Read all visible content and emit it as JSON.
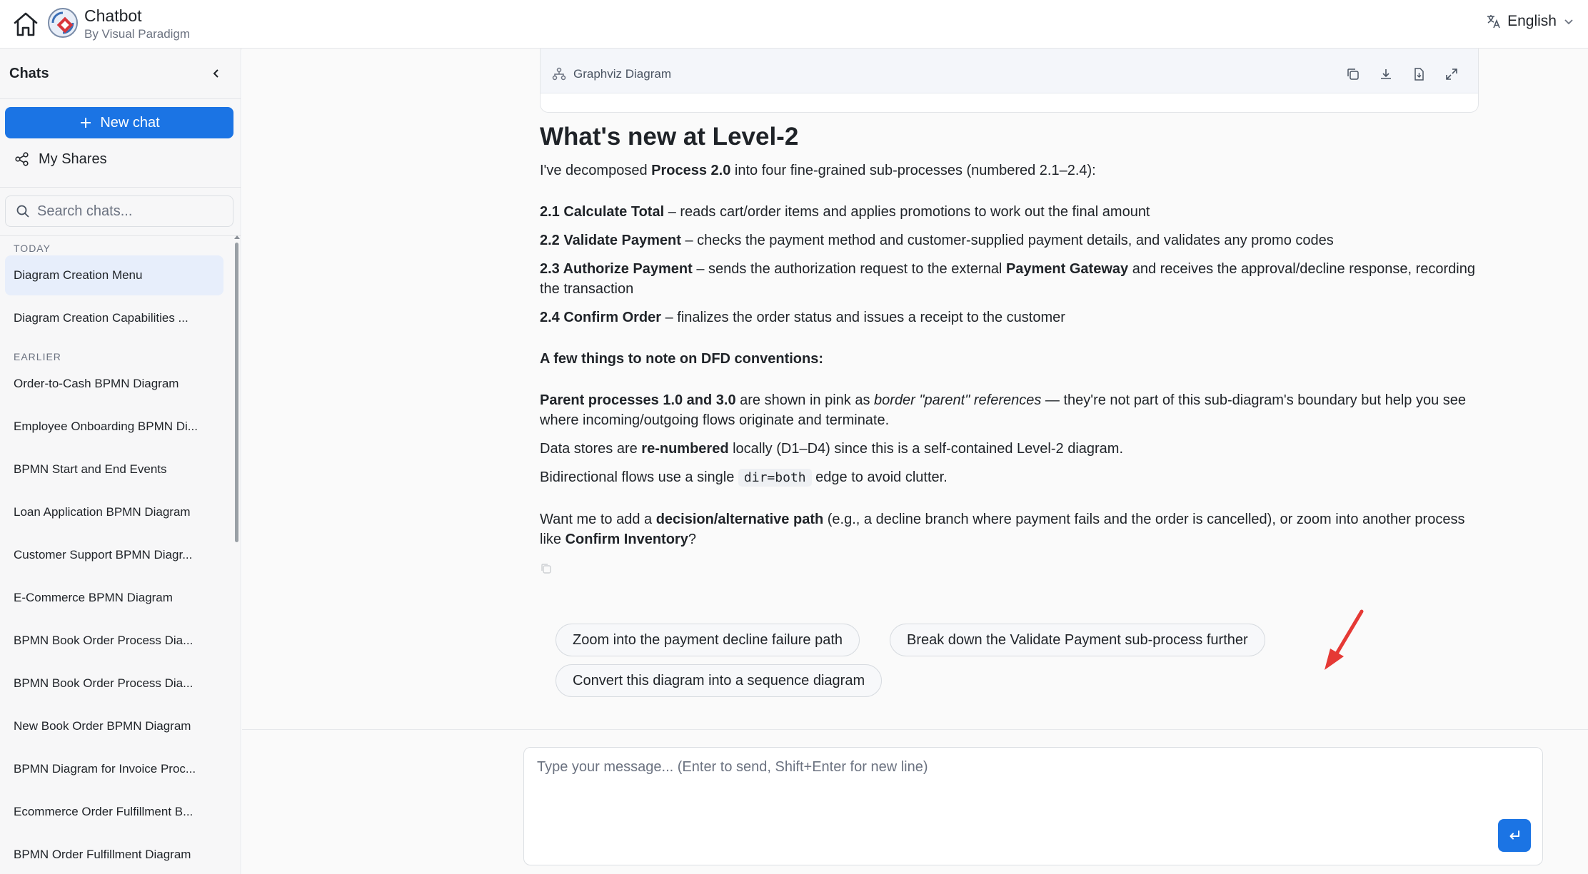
{
  "header": {
    "app_title": "Chatbot",
    "app_subtitle": "By Visual Paradigm",
    "language": "English"
  },
  "sidebar": {
    "title": "Chats",
    "new_chat_label": "New chat",
    "my_shares_label": "My Shares",
    "search_placeholder": "Search chats...",
    "sections": [
      {
        "label": "TODAY",
        "items": [
          "Diagram Creation Menu",
          "Diagram Creation Capabilities ..."
        ]
      },
      {
        "label": "EARLIER",
        "items": [
          "Order-to-Cash BPMN Diagram",
          "Employee Onboarding BPMN Di...",
          "BPMN Start and End Events",
          "Loan Application BPMN Diagram",
          "Customer Support BPMN Diagr...",
          "E-Commerce BPMN Diagram",
          "BPMN Book Order Process Dia...",
          "BPMN Book Order Process Dia...",
          "New Book Order BPMN Diagram",
          "BPMN Diagram for Invoice Proc...",
          "Ecommerce Order Fulfillment B...",
          "BPMN Order Fulfillment Diagram"
        ]
      }
    ],
    "active_item": "Diagram Creation Menu"
  },
  "diagram_card": {
    "title": "Graphviz Diagram",
    "tools": [
      "copy-icon",
      "download-icon",
      "export-icon",
      "fullscreen-icon"
    ]
  },
  "message": {
    "heading": "What's new at Level-2",
    "intro_pre": "I've decomposed ",
    "intro_bold": "Process 2.0",
    "intro_post": " into four fine-grained sub-processes (numbered 2.1–2.4):",
    "subprocesses": [
      {
        "bold": "2.1 Calculate Total",
        "text": " – reads cart/order items and applies promotions to work out the final amount"
      },
      {
        "bold": "2.2 Validate Payment",
        "text": " – checks the payment method and customer-supplied payment details, and validates any promo codes"
      },
      {
        "bold": "2.3 Authorize Payment",
        "text": " – sends the authorization request to the external ",
        "bold2": "Payment Gateway",
        "text2": " and receives the approval/decline response, recording the transaction"
      },
      {
        "bold": "2.4 Confirm Order",
        "text": " – finalizes the order status and issues a receipt to the customer"
      }
    ],
    "notes_heading": "A few things to note on DFD conventions:",
    "note1_bold": "Parent processes 1.0 and 3.0",
    "note1_mid": " are shown in pink as ",
    "note1_italic": "border \"parent\" references",
    "note1_post": " — they're not part of this sub-diagram's boundary but help you see where incoming/outgoing flows originate and terminate.",
    "note2_pre": "Data stores are ",
    "note2_bold": "re-numbered",
    "note2_post": " locally (D1–D4) since this is a self-contained Level-2 diagram.",
    "note3_pre": "Bidirectional flows use a single ",
    "note3_code": "dir=both",
    "note3_post": " edge to avoid clutter.",
    "closing_pre": "Want me to add a ",
    "closing_bold": "decision/alternative path",
    "closing_mid": " (e.g., a decline branch where payment fails and the order is cancelled), or zoom into another process like ",
    "closing_bold2": "Confirm Inventory",
    "closing_post": "?"
  },
  "suggestions": [
    "Zoom into the payment decline failure path",
    "Break down the Validate Payment sub-process further",
    "Convert this diagram into a sequence diagram"
  ],
  "composer": {
    "placeholder": "Type your message... (Enter to send, Shift+Enter for new line)"
  },
  "colors": {
    "primary": "#1b74e4",
    "annotation_arrow": "#e53935",
    "active_item_bg": "#e7eefb"
  }
}
